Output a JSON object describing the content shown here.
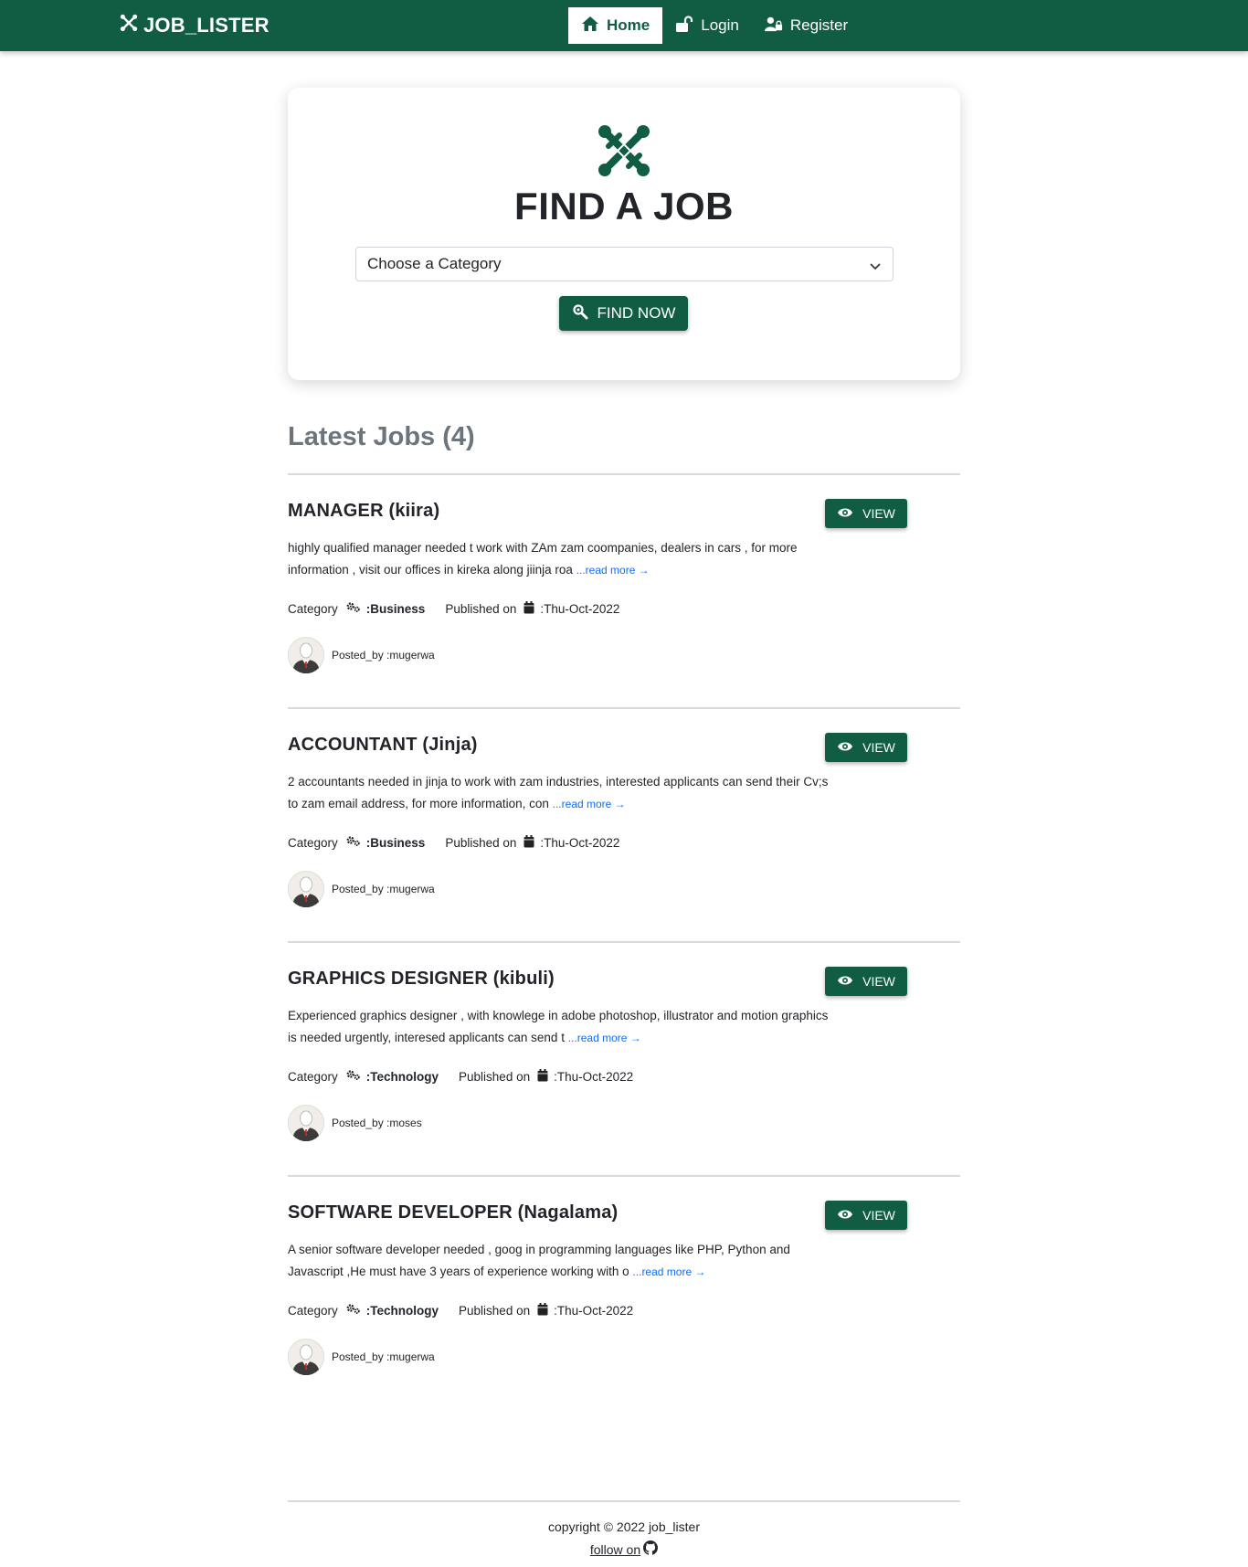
{
  "navbar": {
    "brand": "JOB_LISTER",
    "items": [
      {
        "label": "Home",
        "icon": "home-icon",
        "active": true
      },
      {
        "label": "Login",
        "icon": "unlock-icon",
        "active": false
      },
      {
        "label": "Register",
        "icon": "user-lock-icon",
        "active": false
      }
    ]
  },
  "hero": {
    "title": "FIND A JOB",
    "select_value": "Choose a Category",
    "button_label": "FIND NOW"
  },
  "latest": {
    "title": "Latest Jobs (4)"
  },
  "jobs": [
    {
      "title": "MANAGER (kiira)",
      "view_label": "VIEW",
      "description": "highly qualified manager needed t work with ZAm zam coompanies, dealers in cars , for more information , visit our offices in kireka along jiinja roa",
      "read_more": "...read more →",
      "category_label": "Category",
      "category": ":Business",
      "published_label": "Published on",
      "published": ":Thu-Oct-2022",
      "posted_by": "Posted_by :mugerwa"
    },
    {
      "title": "ACCOUNTANT (Jinja)",
      "view_label": "VIEW",
      "description": "2 accountants needed in jinja to work with zam industries, interested applicants can send their Cv;s to zam email address, for more information, con",
      "read_more": "...read more →",
      "category_label": "Category",
      "category": ":Business",
      "published_label": "Published on",
      "published": ":Thu-Oct-2022",
      "posted_by": "Posted_by :mugerwa"
    },
    {
      "title": "GRAPHICS DESIGNER (kibuli)",
      "view_label": "VIEW",
      "description": "Experienced graphics designer , with knowlege in adobe photoshop, illustrator and motion graphics is needed urgently, interesed applicants can send t",
      "read_more": "...read more →",
      "category_label": "Category",
      "category": ":Technology",
      "published_label": "Published on",
      "published": ":Thu-Oct-2022",
      "posted_by": "Posted_by :moses"
    },
    {
      "title": "SOFTWARE DEVELOPER (Nagalama)",
      "view_label": "VIEW",
      "description": "A senior software developer needed , goog in programming languages like PHP, Python and Javascript ,He must have 3 years of experience working with o",
      "read_more": "...read more →",
      "category_label": "Category",
      "category": ":Technology",
      "published_label": "Published on",
      "published": ":Thu-Oct-2022",
      "posted_by": "Posted_by :mugerwa"
    }
  ],
  "footer": {
    "copyright": "copyright © 2022  job_lister",
    "follow": "follow on"
  },
  "colors": {
    "brand": "#115d44",
    "link": "#0d6efd",
    "muted": "#6c757d"
  }
}
